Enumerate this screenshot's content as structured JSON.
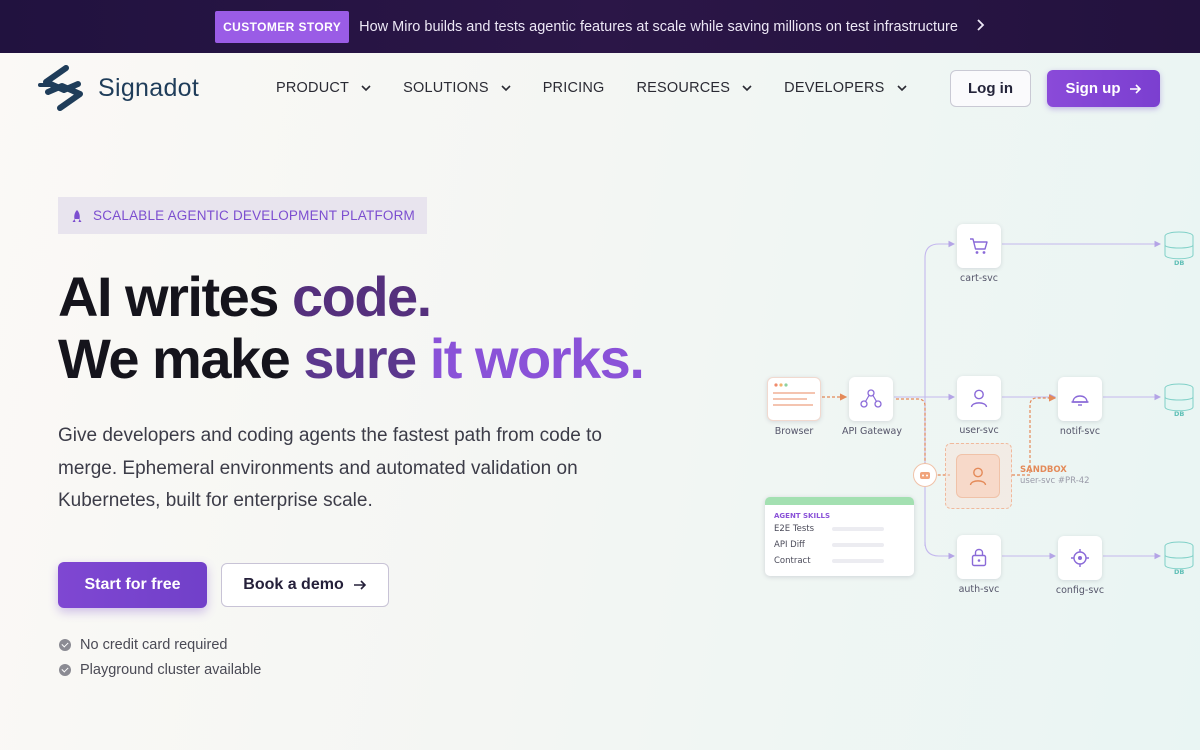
{
  "announcement": {
    "badge": "CUSTOMER STORY",
    "message": "How Miro builds and tests agentic features at scale while saving millions on test infrastructure",
    "arrow_icon": "chevron-right-icon"
  },
  "nav": {
    "brand": "Signadot",
    "menu": [
      {
        "label": "PRODUCT",
        "has_dropdown": true
      },
      {
        "label": "SOLUTIONS",
        "has_dropdown": true
      },
      {
        "label": "PRICING",
        "has_dropdown": false
      },
      {
        "label": "RESOURCES",
        "has_dropdown": true
      },
      {
        "label": "DEVELOPERS",
        "has_dropdown": true
      }
    ],
    "login_label": "Log in",
    "signup_label": "Sign up"
  },
  "hero": {
    "pill_label": "SCALABLE AGENTIC DEVELOPMENT PLATFORM",
    "headline_line1_a": "AI writes ",
    "headline_line1_b": "code.",
    "headline_line2_a": "We make ",
    "headline_line2_b": "sure ",
    "headline_line2_c": "it works.",
    "subtitle": "Give developers and coding agents the fastest path from code to merge. Ephemeral environments and automated validation on Kubernetes, built for enterprise scale.",
    "primary_cta": "Start for free",
    "secondary_cta": "Book a demo",
    "checks": [
      "No credit card required",
      "Playground cluster available"
    ]
  },
  "diagram": {
    "nodes": {
      "browser": "Browser",
      "gateway": "API Gateway",
      "cart": "cart-svc",
      "user": "user-svc",
      "notif": "notif-svc",
      "auth": "auth-svc",
      "config": "config-svc"
    },
    "sandbox_title": "SANDBOX",
    "sandbox_sub": "user-svc #PR-42",
    "db_label": "DB",
    "skills": {
      "title": "AGENT SKILLS",
      "items": [
        "E2E Tests",
        "API Diff",
        "Contract"
      ]
    }
  },
  "colors": {
    "accent": "#7f47d2",
    "announce_bg": "#24133f",
    "badge": "#9a5ce6",
    "sandbox": "#e48a59"
  }
}
